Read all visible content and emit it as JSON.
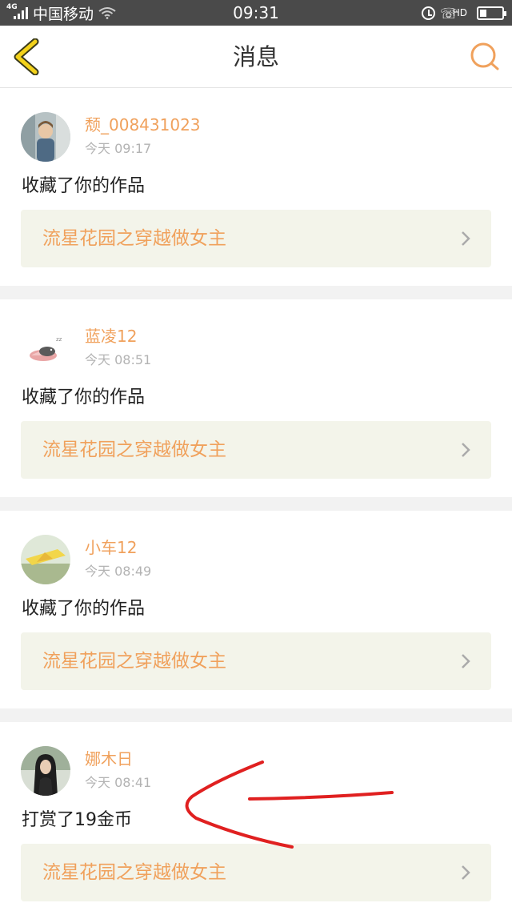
{
  "status_bar": {
    "network_type": "4G",
    "carrier": "中国移动",
    "time": "09:31",
    "hd_label": "HD",
    "icons": [
      "signal-icon",
      "wifi-icon",
      "alarm-icon",
      "hd-call-icon",
      "battery-icon"
    ],
    "battery_level": 0.3
  },
  "header": {
    "title": "消息",
    "back_icon": "chevron-left-icon",
    "search_icon": "search-icon"
  },
  "messages": [
    {
      "username": "颓_008431023",
      "time": "今天 09:17",
      "action": "收藏了你的作品",
      "work_title": "流星花园之穿越做女主"
    },
    {
      "username": "蓝凌12",
      "time": "今天 08:51",
      "action": "收藏了你的作品",
      "work_title": "流星花园之穿越做女主"
    },
    {
      "username": "小车12",
      "time": "今天 08:49",
      "action": "收藏了你的作品",
      "work_title": "流星花园之穿越做女主"
    },
    {
      "username": "娜木日",
      "time": "今天 08:41",
      "action": "打赏了19金币",
      "work_title": "流星花园之穿越做女主"
    }
  ],
  "colors": {
    "accent": "#f0a15c",
    "back_icon": "#f3d21b",
    "card_work_bg": "#f3f4ea",
    "annotation": "#e02020",
    "status_bar_bg": "#4a4a4a"
  }
}
